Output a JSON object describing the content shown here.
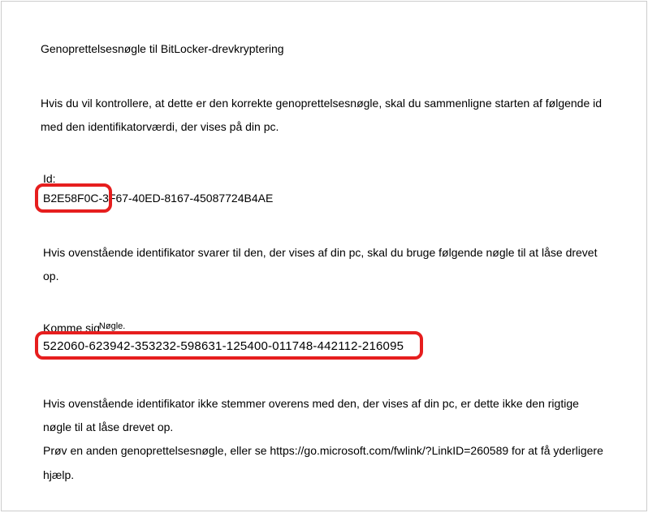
{
  "title": "Genoprettelsesnøgle til BitLocker-drevkryptering",
  "instruction": "Hvis du vil kontrollere, at dette er den korrekte genoprettelsesnøgle, skal du sammenligne starten af følgende id med den identifikatorværdi, der vises på din pc.",
  "id_label": "Id:",
  "id_value": "B2E58F0C-3F67-40ED-8167-45087724B4AE",
  "verify_instruction": "Hvis ovenstående identifikator svarer til den, der vises af din pc, skal du bruge følgende nøgle til at låse drevet op.",
  "key_label_1": "Komme sig",
  "key_label_2": "Nøgle.",
  "key_value": "522060-623942-353232-598631-125400-011748-442112-216095",
  "footer_1": "Hvis ovenstående identifikator ikke stemmer overens med den, der vises af din pc, er dette ikke den rigtige nøgle til at låse drevet op.",
  "footer_2": "Prøv en anden genoprettelsesnøgle, eller se https://go.microsoft.com/fwlink/?LinkID=260589 for at få yderligere hjælp.",
  "highlight_color": "#e61e1e"
}
